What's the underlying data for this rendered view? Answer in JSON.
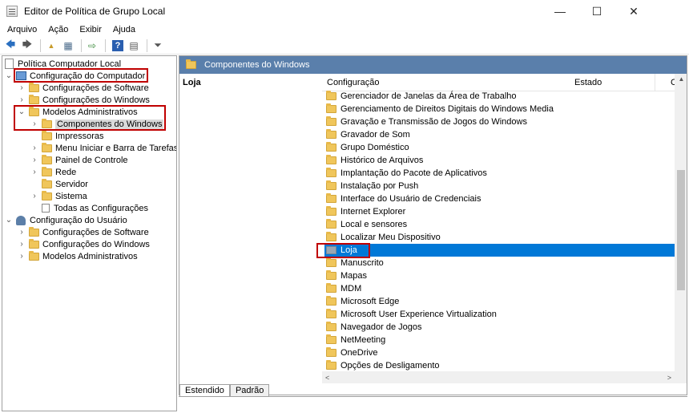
{
  "window": {
    "title": "Editor de Política de Grupo Local",
    "minimize": "—",
    "maximize": "☐",
    "close": "✕"
  },
  "menu": [
    "Arquivo",
    "Ação",
    "Exibir",
    "Ajuda"
  ],
  "toolbar": {
    "back": "🡄",
    "forward": "🡆",
    "up": "▲",
    "show_hide": "▦",
    "export": "⇨",
    "help": "?",
    "properties": "▤",
    "filter": "⏷"
  },
  "tree": {
    "root": "Política Computador Local",
    "computer": "Configuração do Computador",
    "c_software": "Configurações de Software",
    "c_windows": "Configurações do Windows",
    "c_admin": "Modelos Administrativos",
    "c_components": "Componentes do Windows",
    "c_printers": "Impressoras",
    "c_start": "Menu Iniciar e Barra de Tarefas",
    "c_control": "Painel de Controle",
    "c_network": "Rede",
    "c_server": "Servidor",
    "c_system": "Sistema",
    "c_all": "Todas as Configurações",
    "user": "Configuração do Usuário",
    "u_software": "Configurações de Software",
    "u_windows": "Configurações do Windows",
    "u_admin": "Modelos Administrativos"
  },
  "right": {
    "header": "Componentes do Windows",
    "desc_title": "Loja",
    "columns": [
      "Configuração",
      "Estado",
      "C"
    ],
    "items": [
      "Gerenciador de Janelas da Área de Trabalho",
      "Gerenciamento de Direitos Digitais do Windows Media",
      "Gravação e Transmissão de Jogos do Windows",
      "Gravador de Som",
      "Grupo Doméstico",
      "Histórico de Arquivos",
      "Implantação do Pacote de Aplicativos",
      "Instalação por Push",
      "Interface do Usuário de Credenciais",
      "Internet Explorer",
      "Local e sensores",
      "Localizar Meu Dispositivo",
      "Loja",
      "Manuscrito",
      "Mapas",
      "MDM",
      "Microsoft Edge",
      "Microsoft User Experience Virtualization",
      "Navegador de Jogos",
      "NetMeeting",
      "OneDrive",
      "Opções de Desligamento"
    ],
    "scroll_left": "<",
    "scroll_right": ">"
  },
  "tabs": [
    "Estendido",
    "Padrão"
  ]
}
